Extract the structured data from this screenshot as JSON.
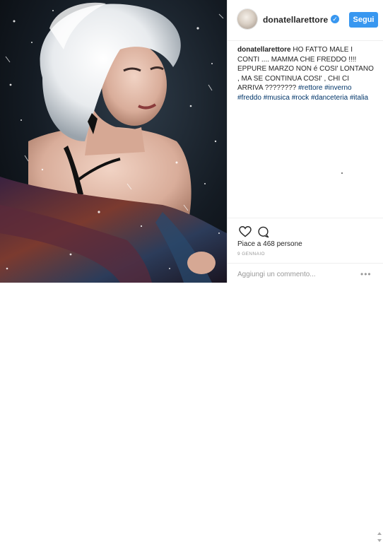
{
  "post": {
    "username": "donatellarettore",
    "follow_label": "Segui",
    "caption_text": "HO FATTO MALE I CONTI .... MAMMA CHE FREDDO !!!! EPPURE MARZO NON é COSI' LONTANO , MA SE CONTINUA COSI' , CHI CI ARRIVA ????????",
    "hashtags": "#rettore #inverno #freddo #musica #rock #danceteria #italia",
    "likes_text": "Piace a 468 persone",
    "date": "9 GENNAIO",
    "comment_placeholder": "Aggiungi un commento...",
    "more_label": "•••"
  },
  "icons": {
    "verified": "verified-badge-icon",
    "like": "heart-icon",
    "comment": "comment-bubble-icon",
    "more": "more-options-icon"
  },
  "colors": {
    "accent": "#3897f0",
    "hashtag": "#003569",
    "text": "#262626",
    "muted": "#999999"
  }
}
